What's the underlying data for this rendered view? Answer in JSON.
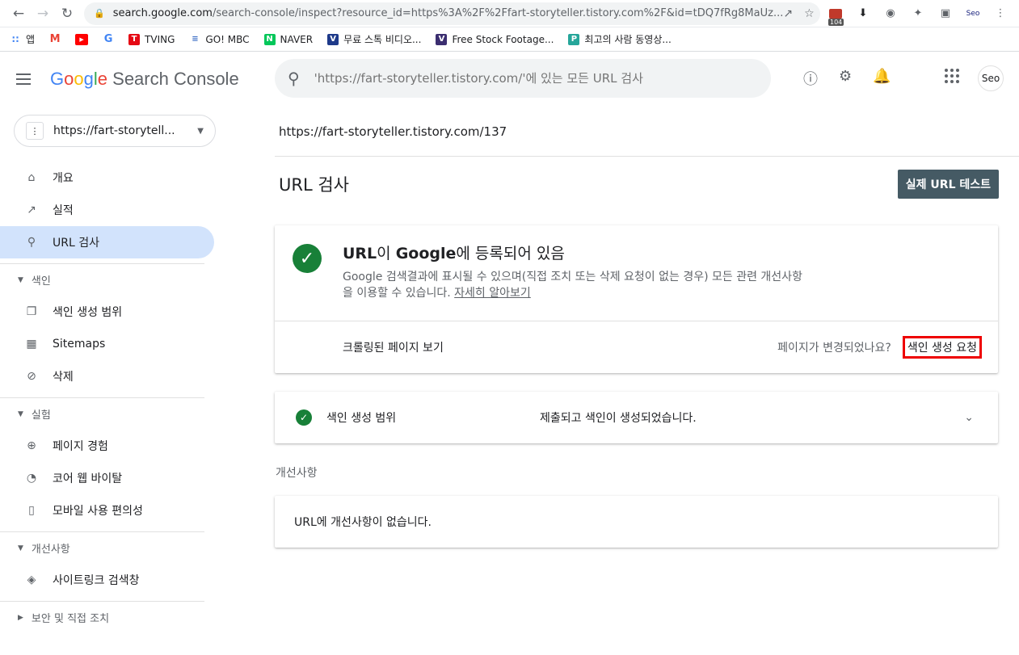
{
  "browser": {
    "url_host": "search.google.com",
    "url_path": "/search-console/inspect?resource_id=https%3A%2F%2Ffart-storyteller.tistory.com%2F&id=tDQ7fRg8MaUz...",
    "ext_badge": "104",
    "profile": "Seo"
  },
  "bookmarks": [
    {
      "label": "앱"
    },
    {
      "label": ""
    },
    {
      "label": ""
    },
    {
      "label": ""
    },
    {
      "label": "TVING"
    },
    {
      "label": "GO! MBC"
    },
    {
      "label": "NAVER"
    },
    {
      "label": "무료 스톡 비디오..."
    },
    {
      "label": "Free Stock Footage..."
    },
    {
      "label": "최고의 사람 동영상..."
    }
  ],
  "header": {
    "logo_google": "Google",
    "logo_product": "Search Console",
    "search_placeholder": "'https://fart-storyteller.tistory.com/'에 있는 모든 URL 검사",
    "avatar": "Seo"
  },
  "sidebar": {
    "property": "https://fart-storytell...",
    "items_top": [
      {
        "label": "개요",
        "icon": "home-icon"
      },
      {
        "label": "실적",
        "icon": "trending-icon"
      },
      {
        "label": "URL 검사",
        "icon": "search-icon"
      }
    ],
    "section_index": "색인",
    "items_index": [
      {
        "label": "색인 생성 범위"
      },
      {
        "label": "Sitemaps"
      },
      {
        "label": "삭제"
      }
    ],
    "section_experience": "실험",
    "items_experience": [
      {
        "label": "페이지 경험"
      },
      {
        "label": "코어 웹 바이탈"
      },
      {
        "label": "모바일 사용 편의성"
      }
    ],
    "section_enhancements": "개선사항",
    "items_enhancements": [
      {
        "label": "사이트링크 검색창"
      }
    ],
    "section_security": "보안 및 직접 조치"
  },
  "main": {
    "inspected_url": "https://fart-storyteller.tistory.com/137",
    "page_title": "URL 검사",
    "test_button": "실제 URL 테스트",
    "status": {
      "title_url": "URL",
      "title_mid": "이 ",
      "title_google": "Google",
      "title_end": "에 등록되어 있음",
      "desc": "Google 검색결과에 표시될 수 있으며(직접 조치 또는 삭제 요청이 없는 경우) 모든 관련 개선사항을 이용할 수 있습니다. ",
      "learn_more": "자세히 알아보기",
      "crawled_link": "크롤링된 페이지 보기",
      "changed_q": "페이지가 변경되었나요?",
      "request_index": "색인 생성 요청"
    },
    "coverage": {
      "label": "색인 생성 범위",
      "value": "제출되고 색인이 생성되었습니다."
    },
    "enhancements_heading": "개선사항",
    "enhancements_none": "URL에 개선사항이 없습니다."
  }
}
